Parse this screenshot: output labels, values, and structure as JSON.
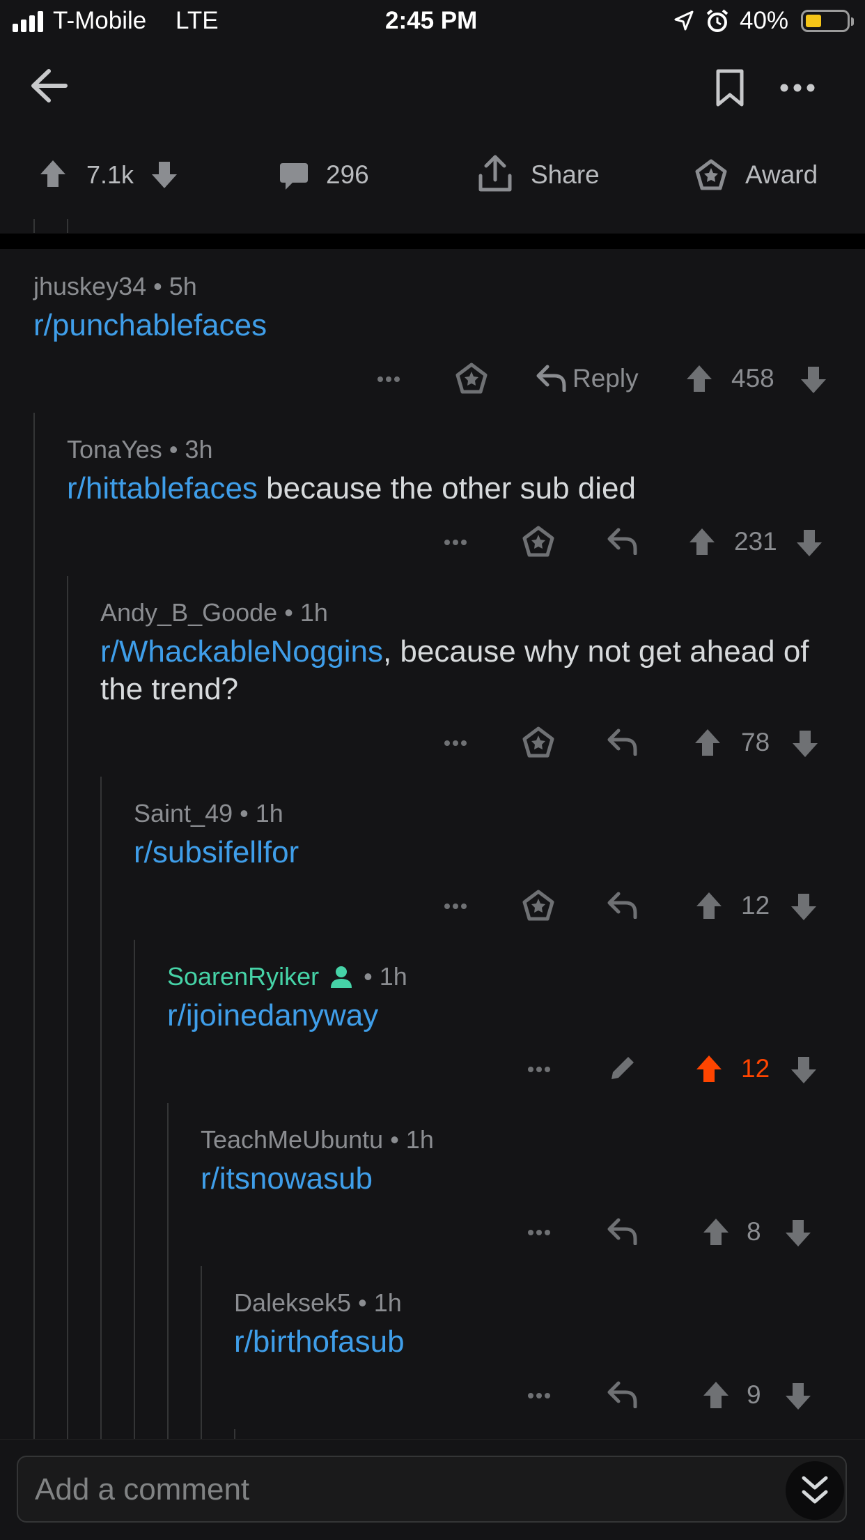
{
  "status_bar": {
    "carrier": "T-Mobile",
    "network": "LTE",
    "time": "2:45 PM",
    "battery": "40%",
    "battery_level": 0.4
  },
  "post_actions": {
    "votes": "7.1k",
    "comments": "296",
    "share": "Share",
    "award": "Award"
  },
  "comments": [
    {
      "author": "jhuskey34",
      "age": "• 5h",
      "link": "r/punchablefaces",
      "text": "",
      "reply_label": "Reply",
      "score": "458"
    },
    {
      "author": "TonaYes",
      "age": "• 3h",
      "link": "r/hittablefaces",
      "text": " because the other sub died",
      "score": "231"
    },
    {
      "author": "Andy_B_Goode",
      "age": "• 1h",
      "link": "r/WhackableNoggins",
      "text": ", because why not get ahead of the trend?",
      "score": "78"
    },
    {
      "author": "Saint_49",
      "age": "• 1h",
      "link": "r/subsifellfor",
      "text": "",
      "score": "12"
    },
    {
      "author": "SoarenRyiker",
      "age": "• 1h",
      "link": "r/ijoinedanyway",
      "text": "",
      "score": "12",
      "upvoted": true
    },
    {
      "author": "TeachMeUbuntu",
      "age": "• 1h",
      "link": "r/itsnowasub",
      "text": "",
      "score": "8"
    },
    {
      "author": "Daleksek5",
      "age": "• 1h",
      "link": "r/birthofasub",
      "text": "",
      "score": "9"
    }
  ],
  "composer": {
    "placeholder": "Add a comment"
  },
  "colors": {
    "background": "#141416",
    "link": "#3f9ee9",
    "op_author": "#46d3a7",
    "upvote": "#ff4500",
    "meta": "#8b8d91"
  }
}
